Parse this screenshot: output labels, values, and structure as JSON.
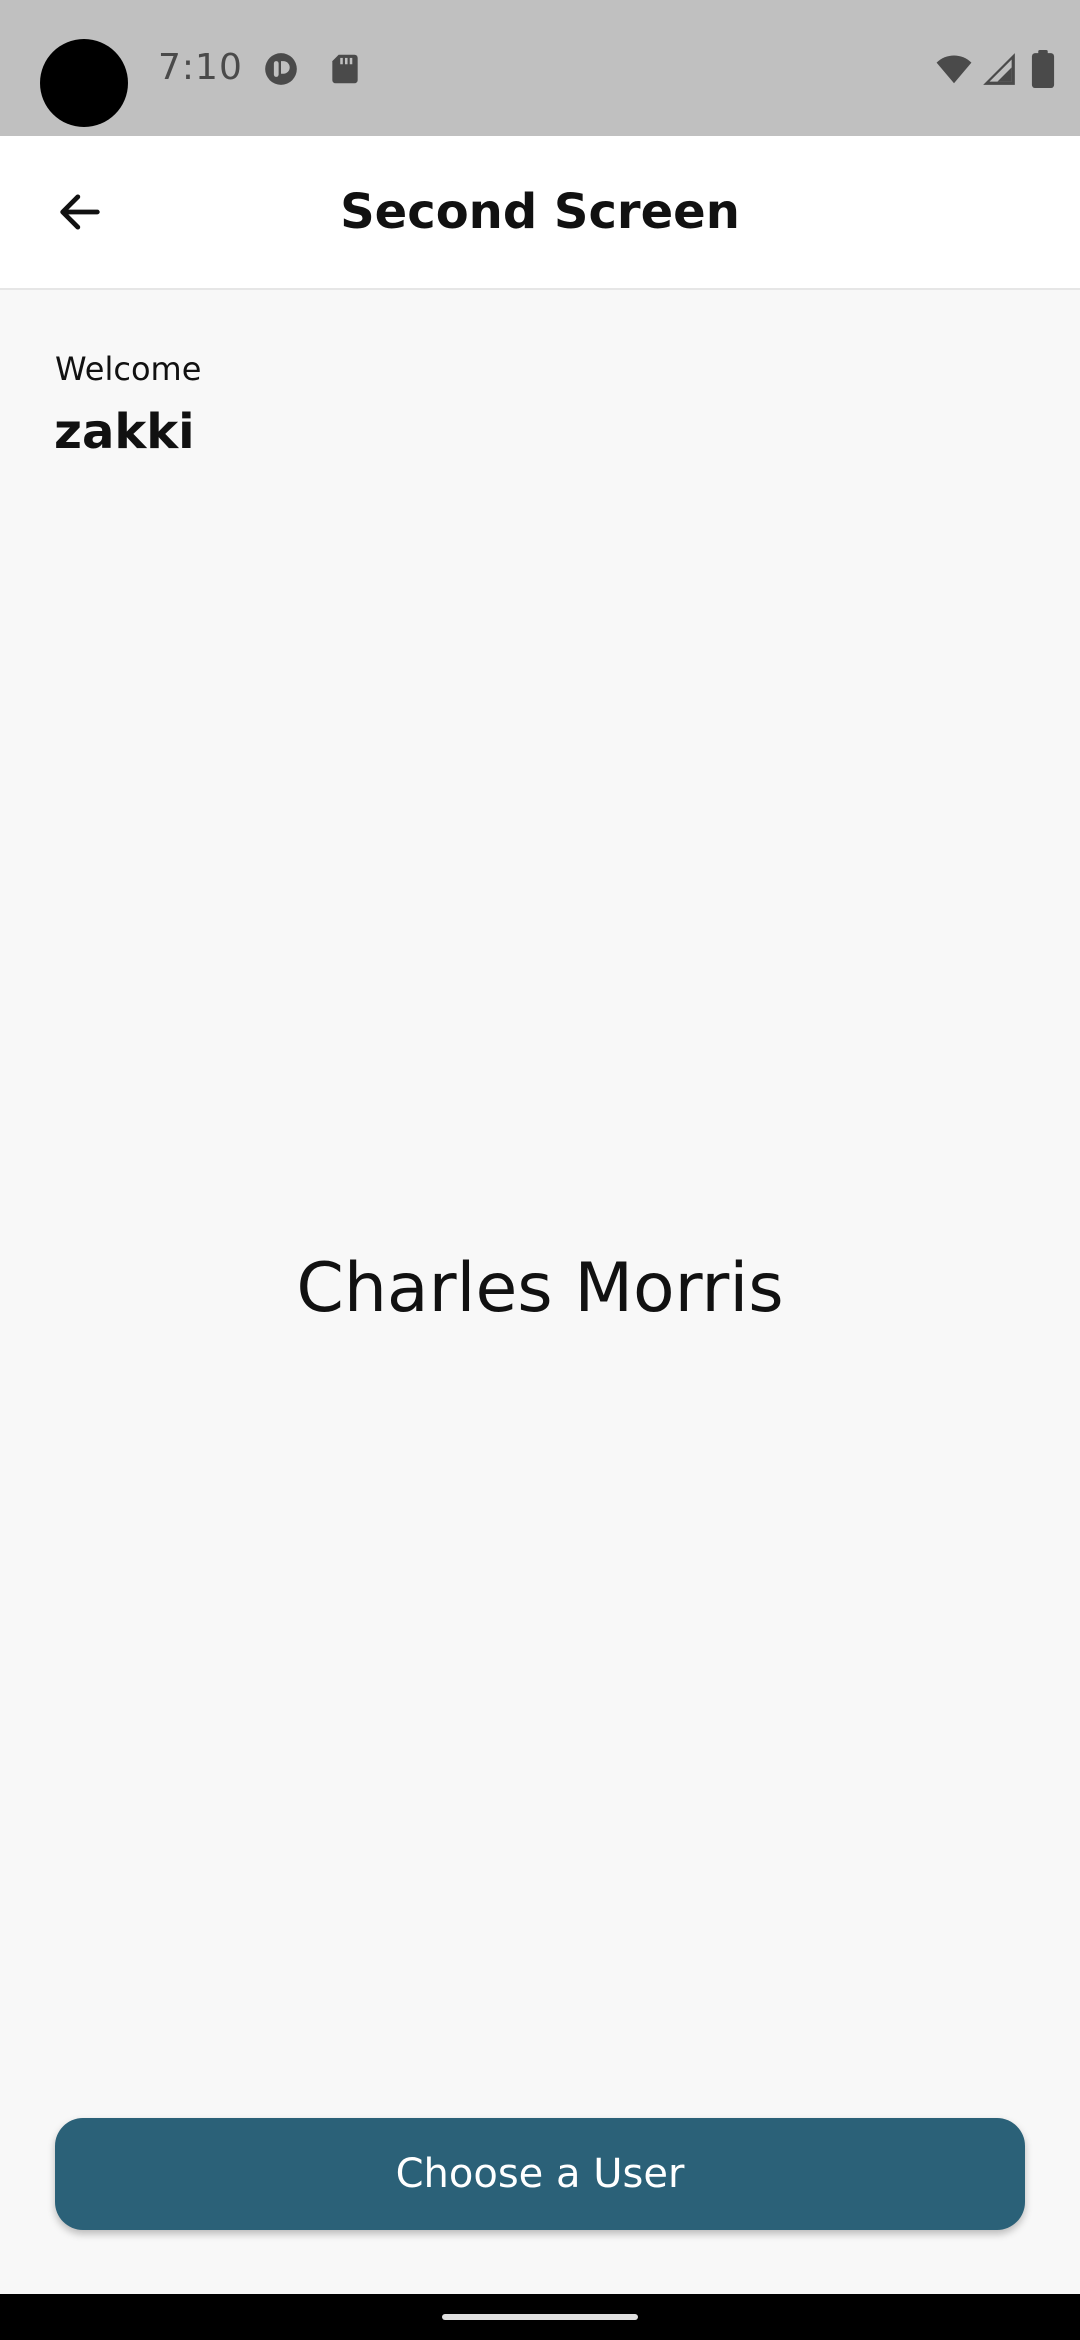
{
  "status_bar": {
    "time": "7:10",
    "icons": [
      "camera-cutout",
      "app-notification-icon",
      "sd-card-icon",
      "wifi-icon",
      "signal-icon",
      "battery-icon"
    ]
  },
  "app_bar": {
    "title": "Second Screen",
    "back_icon": "arrow-back-icon"
  },
  "content": {
    "welcome_label": "Welcome",
    "user_name": "zakki",
    "selected_user_name": "Charles Morris"
  },
  "actions": {
    "choose_user_label": "Choose a User"
  },
  "colors": {
    "status_bar": "#c0c0c0",
    "app_bar": "#ffffff",
    "background": "#f8f8f8",
    "primary_button": "#2b6178",
    "text": "#111111"
  }
}
